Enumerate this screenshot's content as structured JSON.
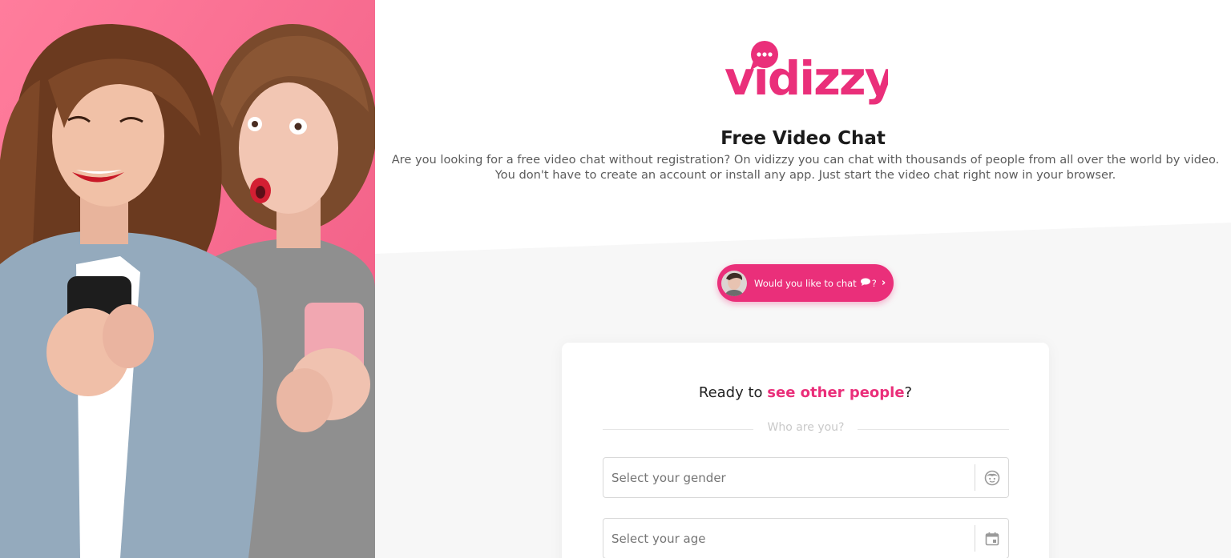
{
  "brand": {
    "name": "vidizzy",
    "color": "#ea2f7a"
  },
  "hero": {
    "background": "#f56a8f"
  },
  "intro": {
    "title": "Free Video Chat",
    "line1": "Are you looking for a free video chat without registration? On vidizzy you can chat with thousands of people from all over the world by video.",
    "line2": "You don't have to create an account or install any app. Just start the video chat right now in your browser."
  },
  "chat_prompt": {
    "label": "Would you like to chat",
    "bubble_icon": "speech-bubble-icon",
    "question_mark": "?",
    "chevron": "›"
  },
  "signup": {
    "title_prefix": "Ready to ",
    "title_accent": "see other people",
    "title_suffix": "?",
    "subtitle": "Who are you?",
    "gender_placeholder": "Select your gender",
    "gender_icon": "face-icon",
    "age_placeholder": "Select your age",
    "age_icon": "calendar-icon"
  }
}
